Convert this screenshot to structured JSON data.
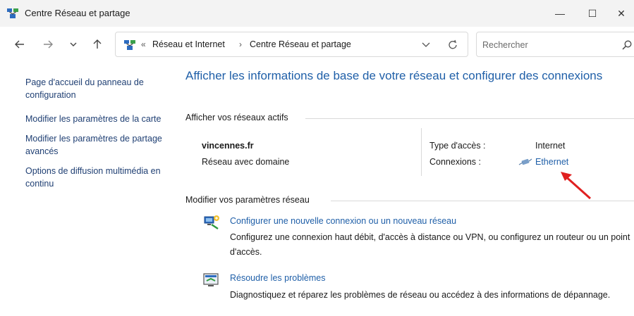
{
  "window": {
    "title": "Centre Réseau et partage",
    "minimize_glyph": "—",
    "maximize_glyph": "☐",
    "close_glyph": "✕"
  },
  "address_bar": {
    "breadcrumbs": [
      "Réseau et Internet",
      "Centre Réseau et partage"
    ],
    "leading_sep": "«",
    "sep": "›"
  },
  "search": {
    "placeholder": "Rechercher"
  },
  "sidebar": {
    "items": [
      {
        "label": "Page d'accueil du panneau de configuration"
      },
      {
        "label": "Modifier les paramètres de la carte"
      },
      {
        "label": "Modifier les paramètres de partage avancés"
      },
      {
        "label": "Options de diffusion multimédia en continu"
      }
    ]
  },
  "main": {
    "title": "Afficher les informations de base de votre réseau et configurer des connexions",
    "active_networks_heading": "Afficher vos réseaux actifs",
    "network": {
      "name": "vincennes.fr",
      "category": "Réseau avec domaine",
      "access_type_label": "Type d'accès :",
      "access_type_value": "Internet",
      "connections_label": "Connexions :",
      "connection_link": "Ethernet"
    },
    "settings_heading": "Modifier vos paramètres réseau",
    "tasks": [
      {
        "icon": "network-setup-icon",
        "link": "Configurer une nouvelle connexion ou un nouveau réseau",
        "description": "Configurez une connexion haut débit, d'accès à distance ou VPN, ou configurez un routeur ou un point d'accès."
      },
      {
        "icon": "troubleshoot-icon",
        "link": "Résoudre les problèmes",
        "description": "Diagnostiquez et réparez les problèmes de réseau ou accédez à des informations de dépannage."
      }
    ]
  },
  "colors": {
    "link": "#1f5fa8",
    "sidebar_link": "#1f3f73",
    "annotation_arrow": "#e02020"
  }
}
